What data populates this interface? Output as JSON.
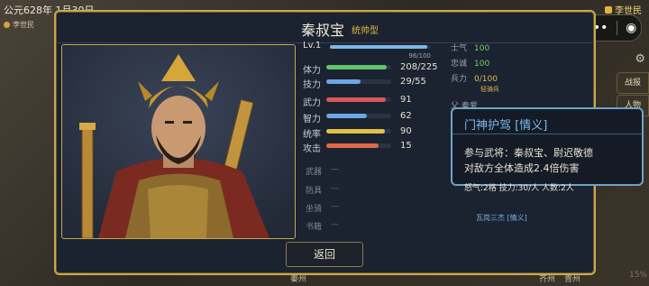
{
  "hud": {
    "era": "公元628年 1月30日",
    "era_sub": "李世民",
    "bg_title": "",
    "player": "李世民",
    "side_buttons": [
      "战报",
      "人物"
    ],
    "map_labels": [
      "秦州",
      "齐州",
      "青州"
    ],
    "bottom_right": "15%"
  },
  "panel": {
    "name": "秦叔宝",
    "type": "统帅型",
    "level_label": "Lv.1",
    "level_progress": "96/100",
    "level_fraction": 0.96,
    "stats": [
      {
        "label": "体力",
        "value": "208/225",
        "fraction": 0.924,
        "color": "#5fc56a"
      },
      {
        "label": "技力",
        "value": "29/55",
        "fraction": 0.527,
        "color": "#6aa6e8"
      },
      {
        "label": "武力",
        "value": "91",
        "fraction": 0.91,
        "color": "#d55a5a"
      },
      {
        "label": "智力",
        "value": "62",
        "fraction": 0.62,
        "color": "#6aa6e8"
      },
      {
        "label": "统率",
        "value": "90",
        "fraction": 0.9,
        "color": "#e0c24a"
      },
      {
        "label": "攻击",
        "value": "15",
        "fraction": 0.8,
        "color": "#e06a4a"
      }
    ],
    "equipment": [
      {
        "label": "武器",
        "value": "—"
      },
      {
        "label": "防具",
        "value": "—"
      },
      {
        "label": "坐骑",
        "value": "—"
      },
      {
        "label": "书籍",
        "value": "—"
      }
    ],
    "morale": {
      "label": "士气",
      "value": "100"
    },
    "loyalty": {
      "label": "忠诚",
      "value": "100"
    },
    "troops": {
      "label": "兵力",
      "value": "0/100",
      "sub": "轻骑兵"
    },
    "relation": "父 秦爱",
    "partner_skill": "瓦岗三杰 [情义]",
    "back_label": "返回"
  },
  "tooltip": {
    "title": "门神护驾 [情义]",
    "line1": "参与武将：秦叔宝、尉迟敬德",
    "line2": "对敌方全体造成2.4倍伤害",
    "line3": "怒气:2格  技力:30/人  人数:2人"
  }
}
